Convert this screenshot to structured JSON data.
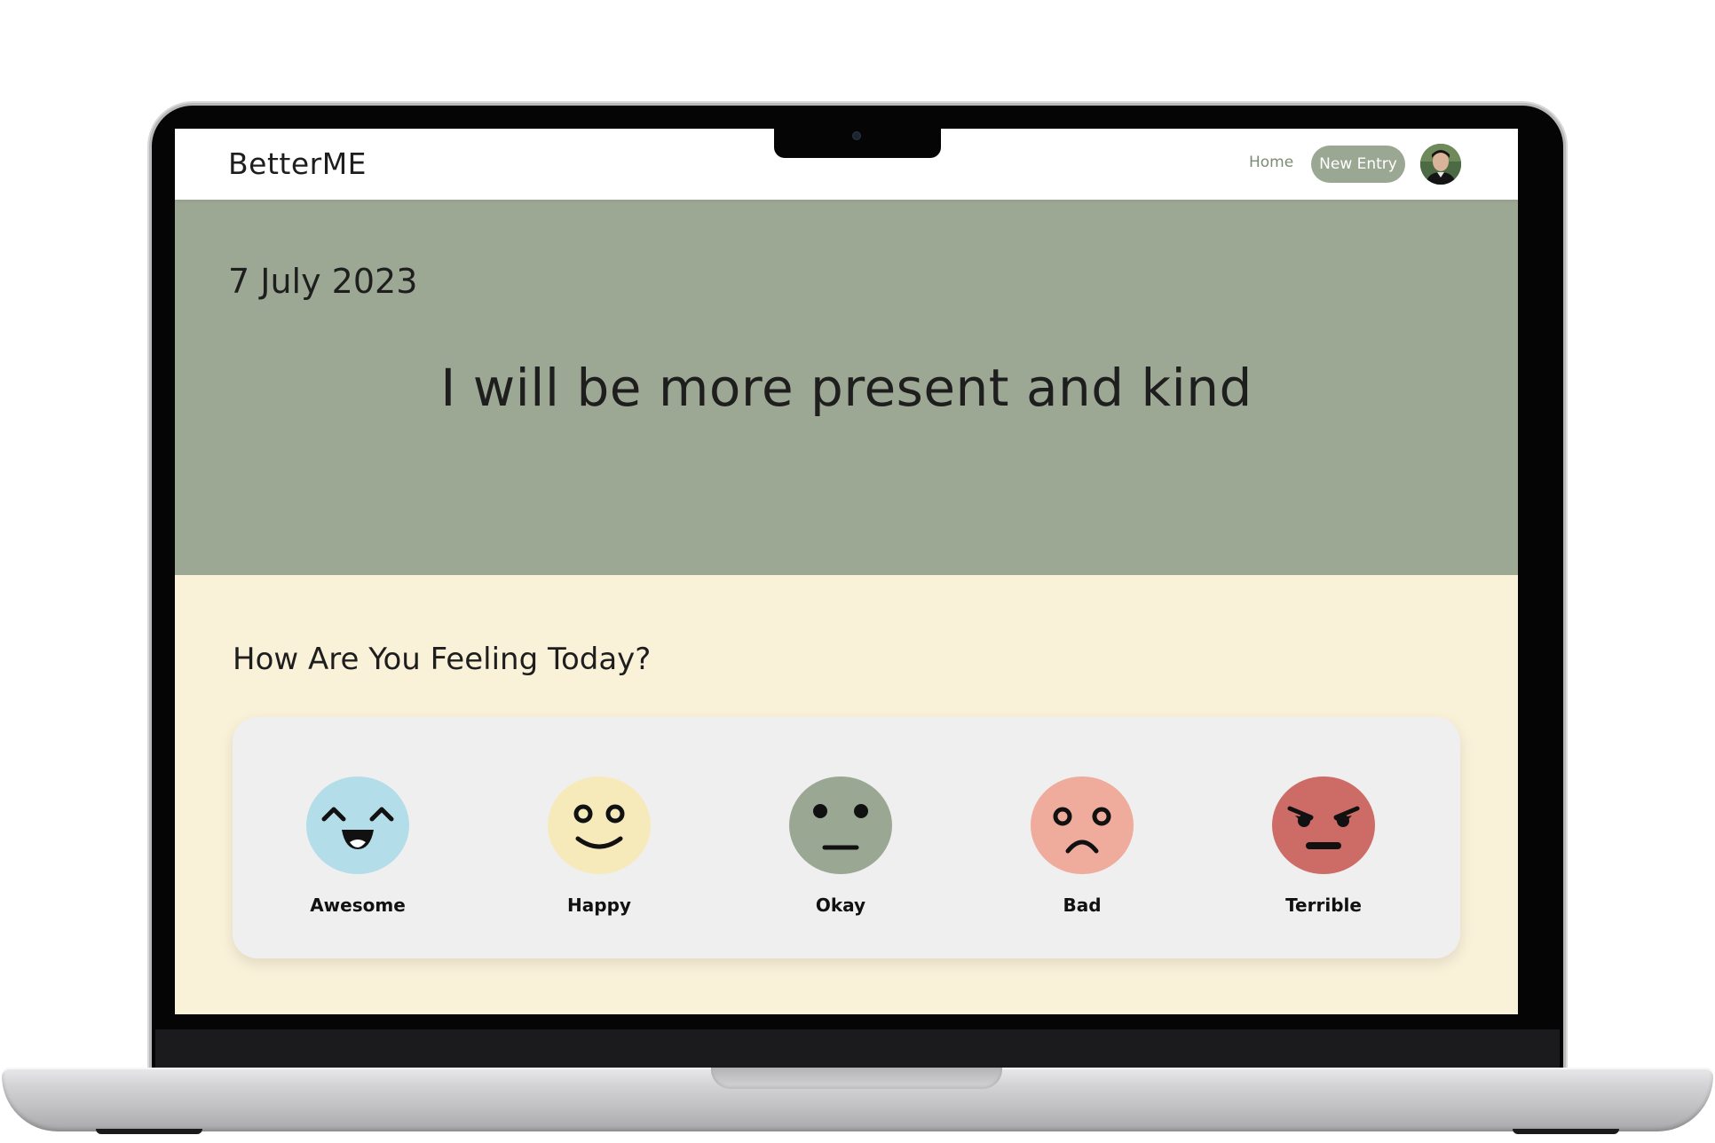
{
  "app": {
    "brand": "BetterME"
  },
  "nav": {
    "home_label": "Home",
    "new_entry_label": "New Entry"
  },
  "hero": {
    "date": "7 July 2023",
    "intention": "I will be more present and kind"
  },
  "mood": {
    "heading": "How Are You Feeling Today?",
    "options": [
      {
        "label": "Awesome",
        "icon": "awesome-face-icon",
        "color": "#b3dde8"
      },
      {
        "label": "Happy",
        "icon": "happy-face-icon",
        "color": "#f6eabb"
      },
      {
        "label": "Okay",
        "icon": "okay-face-icon",
        "color": "#9aa893"
      },
      {
        "label": "Bad",
        "icon": "bad-face-icon",
        "color": "#efab9b"
      },
      {
        "label": "Terrible",
        "icon": "terrible-face-icon",
        "color": "#cd6b67"
      }
    ]
  },
  "colors": {
    "hero_bg": "#9da894",
    "page_bg": "#faf1d9",
    "card_bg": "#efefef",
    "accent": "#9aa893"
  }
}
